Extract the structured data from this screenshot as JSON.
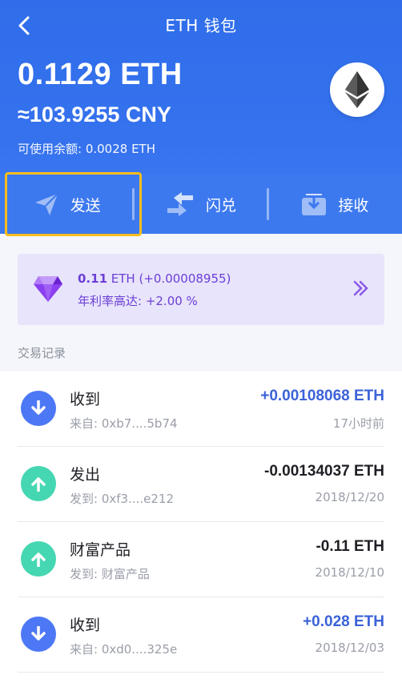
{
  "nav": {
    "title": "ETH 钱包"
  },
  "wallet": {
    "balance": "0.1129 ETH",
    "balance_cny": "≈103.9255 CNY",
    "available": "可使用余额: 0.0028 ETH"
  },
  "actions": {
    "send_label": "发送",
    "swap_label": "闪兑",
    "receive_label": "接收"
  },
  "earn": {
    "amount": "0.11",
    "unit": " ETH",
    "gain": " (+0.00008955)",
    "rate": "年利率高达: +2.00 %"
  },
  "transactions_title": "交易记录",
  "transactions": [
    {
      "title": "收到",
      "sub": "来自: 0xb7....5b74",
      "amount": "+0.00108068 ETH",
      "time": "17小时前",
      "direction": "in"
    },
    {
      "title": "发出",
      "sub": "发到: 0xf3....e212",
      "amount": "-0.00134037 ETH",
      "time": "2018/12/20",
      "direction": "out"
    },
    {
      "title": "财富产品",
      "sub": "发到: 财富产品",
      "amount": "-0.11 ETH",
      "time": "2018/12/10",
      "direction": "out"
    },
    {
      "title": "收到",
      "sub": "来自: 0xd0....325e",
      "amount": "+0.028 ETH",
      "time": "2018/12/03",
      "direction": "in"
    }
  ],
  "colors": {
    "header": "#3672ee",
    "in_icon": "#4d78f5",
    "out_icon": "#45d7b1",
    "in_amount": "#3b62d8",
    "out_amount": "#1e1f24",
    "highlight": "#f7bd1b",
    "earn_bg": "#e8e4fb",
    "earn_text": "#6b3fd6"
  },
  "icons": {
    "back": "chevron-left-icon",
    "coin": "ethereum-icon",
    "send": "paper-plane-icon",
    "swap": "swap-arrows-icon",
    "receive": "inbox-download-icon",
    "earn": "diamond-icon",
    "earn_arrow": "double-chevron-right-icon",
    "in": "arrow-down-icon",
    "out": "arrow-up-icon"
  }
}
